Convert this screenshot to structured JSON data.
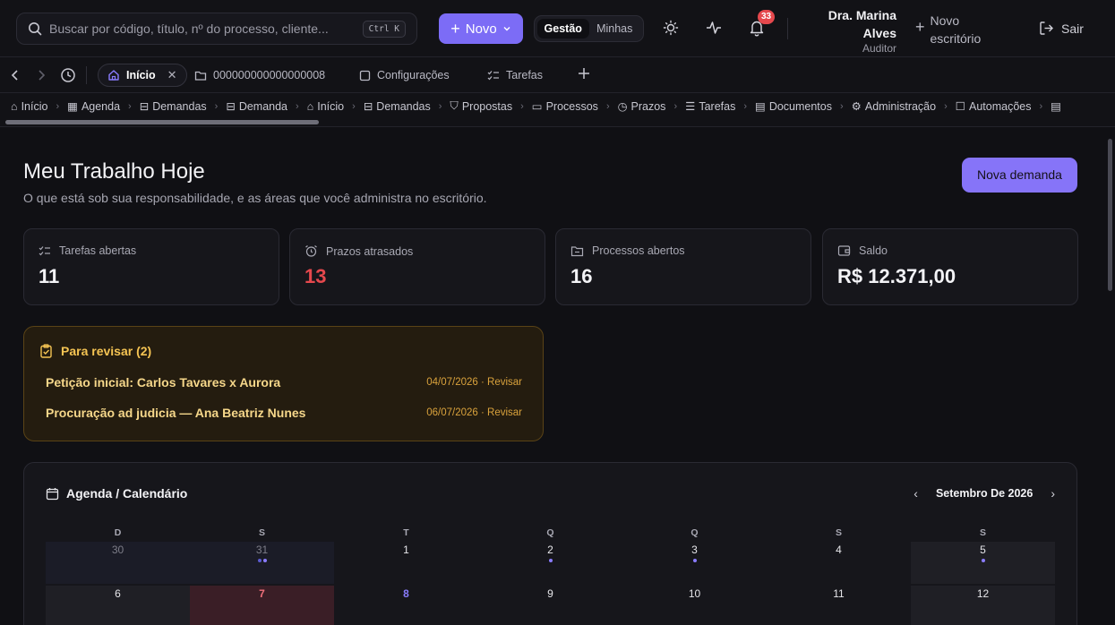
{
  "header": {
    "search_placeholder": "Buscar por código, título, nº do processo, cliente...",
    "search_shortcut": "Ctrl K",
    "new_button": "Novo",
    "segment": {
      "active": "Gestão",
      "inactive": "Minhas"
    },
    "notifications_count": "33",
    "user": {
      "name_line1": "Dra. Marina",
      "name_line2": "Alves",
      "role": "Auditor"
    },
    "new_office": {
      "line1": "Novo",
      "line2": "escritório"
    },
    "logout": "Sair"
  },
  "tabs": [
    {
      "label": "Início",
      "active": true
    },
    {
      "label": "000000000000000008"
    },
    {
      "label": "Configurações"
    },
    {
      "label": "Tarefas"
    }
  ],
  "breadcrumbs": [
    "Início",
    "Agenda",
    "Demandas",
    "Demanda",
    "Início",
    "Demandas",
    "Propostas",
    "Processos",
    "Prazos",
    "Tarefas",
    "Documentos",
    "Administração",
    "Automações"
  ],
  "page": {
    "title": "Meu Trabalho Hoje",
    "subtitle": "O que está sob sua responsabilidade, e as áreas que você administra no escritório.",
    "new_demand_button": "Nova demanda"
  },
  "stats": [
    {
      "label": "Tarefas abertas",
      "value": "11",
      "icon": "checklist-icon"
    },
    {
      "label": "Prazos atrasados",
      "value": "13",
      "icon": "alarm-icon",
      "color": "#e5484d"
    },
    {
      "label": "Processos abertos",
      "value": "16",
      "icon": "folder-icon"
    },
    {
      "label": "Saldo",
      "value": "R$ 12.371,00",
      "icon": "wallet-icon"
    }
  ],
  "review": {
    "title": "Para revisar (2)",
    "items": [
      {
        "title": "Petição inicial: Carlos Tavares x Aurora",
        "meta": "04/07/2026 · Revisar"
      },
      {
        "title": "Procuração ad judicia — Ana Beatriz Nunes",
        "meta": "06/07/2026 · Revisar"
      }
    ]
  },
  "agenda": {
    "title": "Agenda / Calendário",
    "month": "Setembro De 2026",
    "weekdays": [
      "D",
      "S",
      "T",
      "Q",
      "Q",
      "S",
      "S"
    ],
    "week1": [
      "30",
      "31",
      "1",
      "2",
      "3",
      "4",
      "5"
    ],
    "week2": [
      "6",
      "7",
      "8",
      "9",
      "10",
      "11",
      "12"
    ]
  },
  "colors": {
    "accent": "#7c6cf6",
    "danger": "#e5484d",
    "warning": "#f5c453"
  }
}
